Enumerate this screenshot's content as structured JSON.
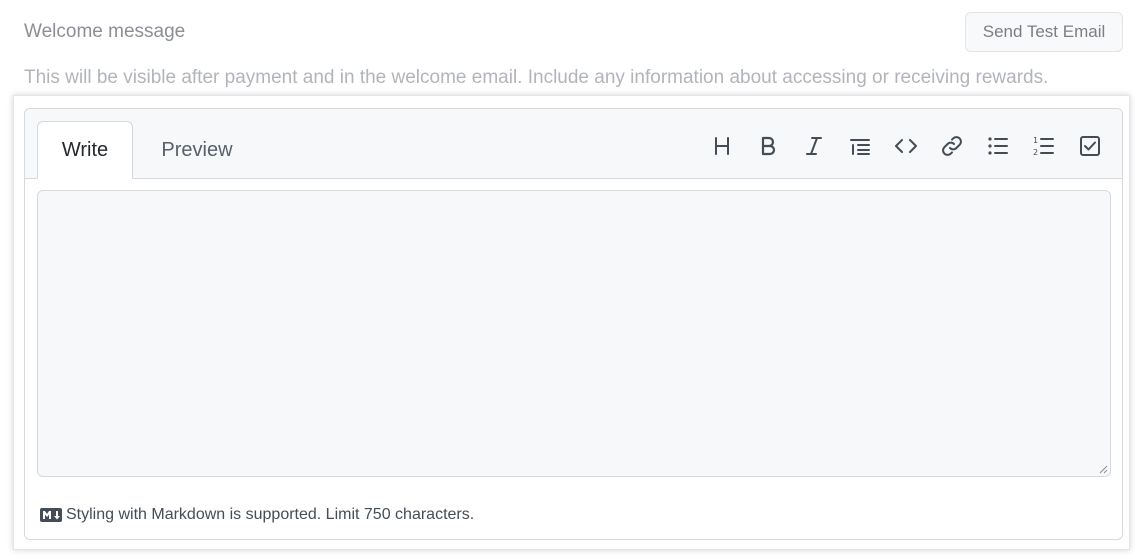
{
  "section": {
    "title": "Welcome message",
    "description": "This will be visible after payment and in the welcome email. Include any information about accessing or receiving rewards.",
    "send_test_label": "Send Test Email"
  },
  "editor": {
    "tabs": [
      {
        "label": "Write",
        "active": true
      },
      {
        "label": "Preview",
        "active": false
      }
    ],
    "toolbar": [
      {
        "icon": "heading-icon"
      },
      {
        "icon": "bold-icon"
      },
      {
        "icon": "italic-icon"
      },
      {
        "icon": "quote-icon"
      },
      {
        "icon": "code-icon"
      },
      {
        "icon": "link-icon"
      },
      {
        "icon": "bulleted-list-icon"
      },
      {
        "icon": "numbered-list-icon"
      },
      {
        "icon": "task-list-icon"
      }
    ],
    "textarea_value": "",
    "footer_note": "Styling with Markdown is supported. Limit 750 characters."
  }
}
